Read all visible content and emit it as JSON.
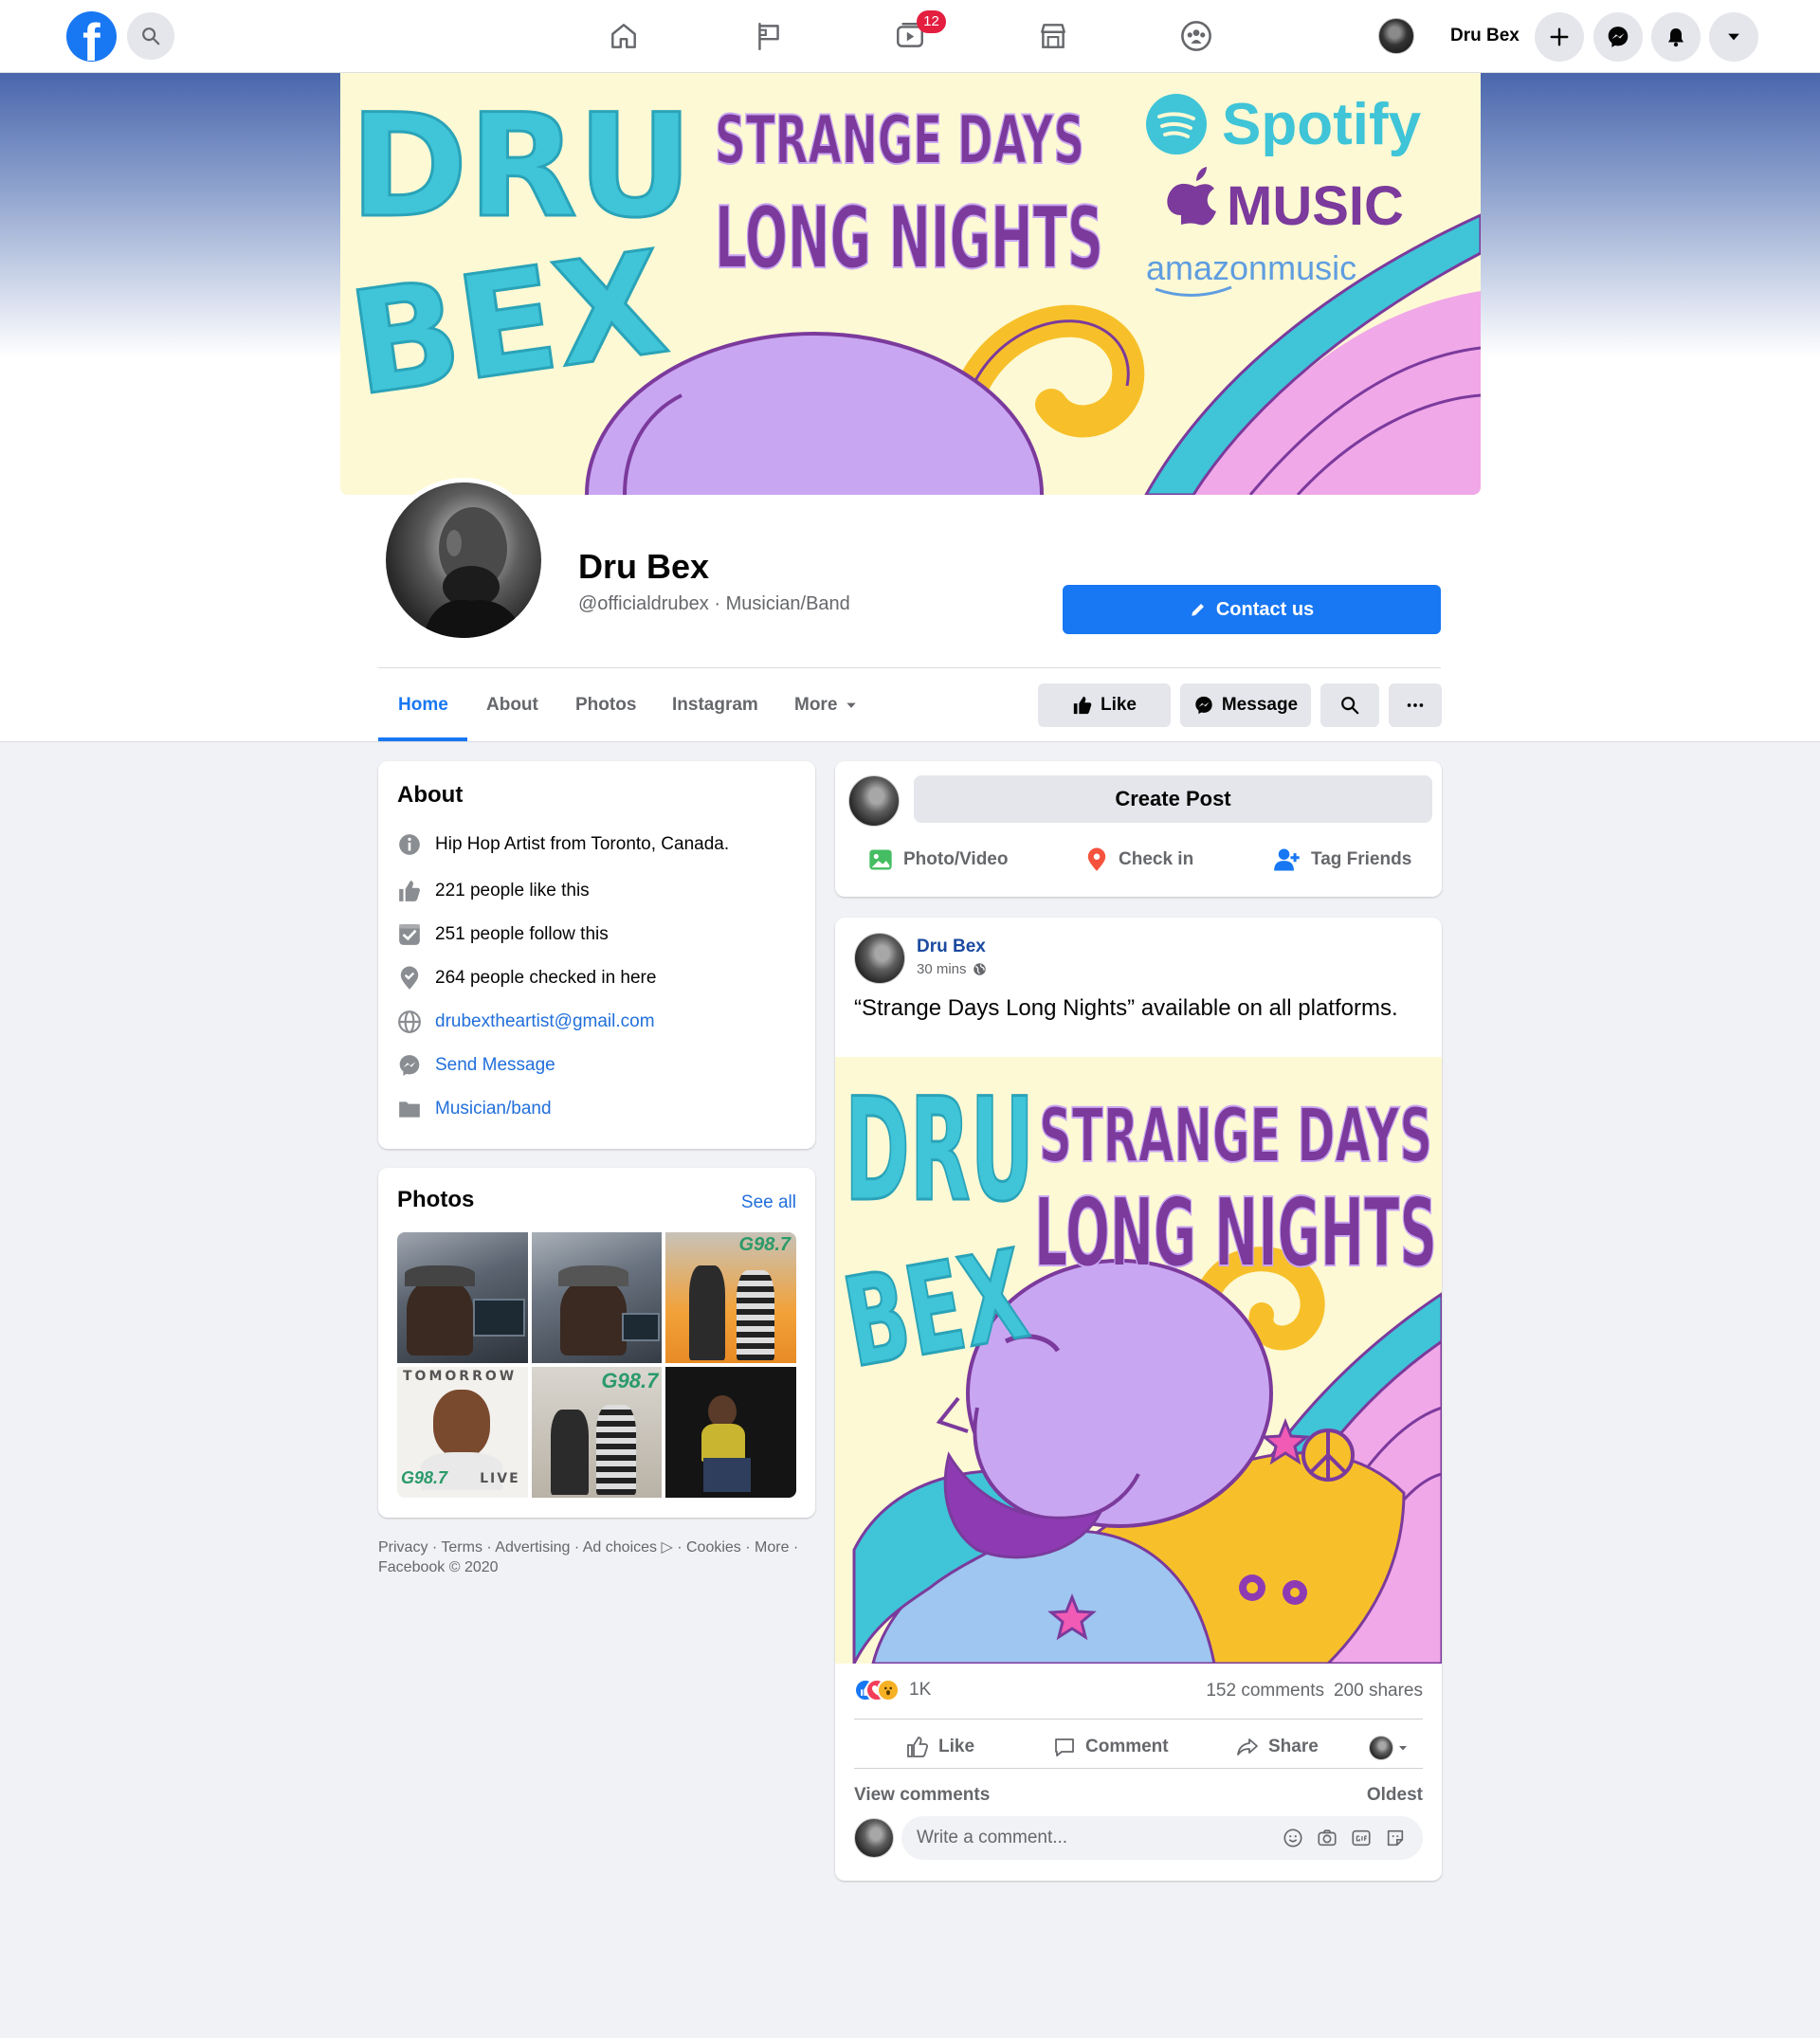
{
  "topbar": {
    "logo": "facebook-logo",
    "logo_letter": "f",
    "notifications_badge": "12",
    "user_name": "Dru Bex",
    "nav_icons": [
      "home-icon",
      "flag-icon",
      "watch-icon",
      "marketplace-icon",
      "groups-icon"
    ],
    "right_icons": [
      "plus-icon",
      "messenger-icon",
      "bell-icon",
      "caret-down-icon"
    ]
  },
  "cover": {
    "artist_word_1": "DRU",
    "artist_word_2": "BEX",
    "album_line_1": "STRANGE DAYS",
    "album_line_2": "LONG NIGHTS",
    "platform_1": "Spotify",
    "platform_2": "MUSIC",
    "platform_3": "amazonmusic"
  },
  "page": {
    "name": "Dru Bex",
    "handle": "@officialdrubex",
    "separator": "·",
    "category": "Musician/Band",
    "contact_button": "Contact us"
  },
  "tabs": [
    {
      "label": "Home",
      "active": true
    },
    {
      "label": "About"
    },
    {
      "label": "Photos"
    },
    {
      "label": "Instagram"
    },
    {
      "label": "More"
    }
  ],
  "actions": {
    "like": "Like",
    "message": "Message"
  },
  "about": {
    "title": "About",
    "description": "Hip Hop Artist from Toronto, Canada.",
    "likes": "221 people like this",
    "follows": "251 people follow this",
    "checkins": "264 people checked in here",
    "email": "drubextheartist@gmail.com",
    "send_message": "Send Message",
    "category_link": "Musician/band"
  },
  "photos": {
    "title": "Photos",
    "see_all": "See all",
    "tile_text_tomorrow": "TOMORROW",
    "tile_text_live": "LIVE",
    "tile_text_station": "G98.7"
  },
  "footer": {
    "text": "Privacy · Terms · Advertising · Ad choices ▷ · Cookies · More · Facebook © 2020"
  },
  "create_post": {
    "button": "Create Post",
    "photo_video": "Photo/Video",
    "check_in": "Check in",
    "tag_friends": "Tag Friends"
  },
  "post": {
    "author": "Dru Bex",
    "time": "30 mins",
    "text": "“Strange Days Long Nights” available on all platforms.",
    "reaction_count": "1K",
    "comments": "152 comments",
    "shares": "200 shares",
    "like": "Like",
    "comment": "Comment",
    "share": "Share",
    "view_comments": "View comments",
    "sort": "Oldest",
    "comment_placeholder": "Write a comment..."
  },
  "colors": {
    "brand": "#1877f2",
    "art_cyan": "#3fc4d8",
    "art_purple": "#7b3a9c",
    "art_lavender": "#c9a6f2",
    "art_yellow": "#f7c02a",
    "art_pink": "#f0a8e8",
    "art_cream": "#fdf9d4"
  }
}
